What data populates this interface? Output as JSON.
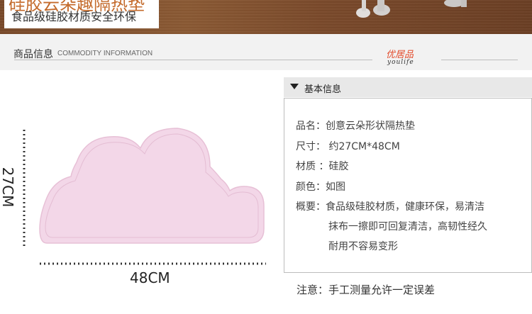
{
  "banner": {
    "title": "硅胶云朵趣隔热垫",
    "subtitle": "食品级硅胶材质安全环保"
  },
  "section": {
    "title": "商品信息",
    "subtitle": "COMMODITY INFORMATION",
    "brand_cn": "优居品",
    "brand_en": "youlife"
  },
  "product": {
    "width_label": "48CM",
    "height_label": "27CM",
    "color": "#f3d6e6"
  },
  "info": {
    "header": "基本信息",
    "specs": [
      "品名：创意云朵形状隔热垫",
      "尺寸： 约27CM*48CM",
      "材质 ：硅胶",
      "颜色：如图",
      "概要：食品级硅胶材质，健康环保，易清洁",
      "抹布一擦即可回复清洁，高韧性经久",
      "耐用不容易变形"
    ],
    "note": "注意：手工测量允许一定误差"
  }
}
